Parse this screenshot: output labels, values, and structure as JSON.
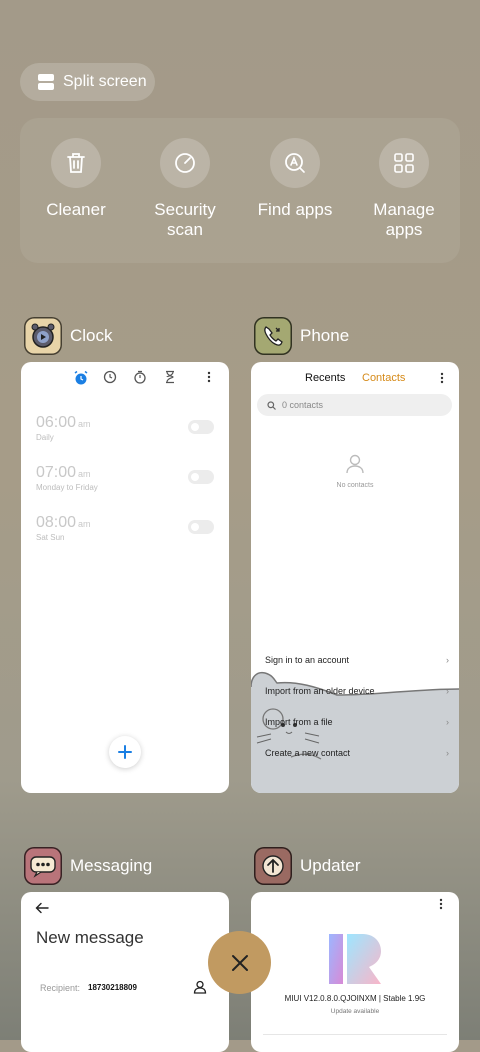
{
  "split_screen": {
    "label": "Split screen",
    "icon": "split-screen-icon"
  },
  "tools": [
    {
      "label": "Cleaner",
      "icon": "trash-icon"
    },
    {
      "label": "Security\nscan",
      "icon": "security-scan-icon"
    },
    {
      "label": "Find apps",
      "icon": "find-apps-icon"
    },
    {
      "label": "Manage\napps",
      "icon": "grid-icon"
    }
  ],
  "apps": {
    "clock": {
      "name": "Clock",
      "alarms": [
        {
          "time": "06:00",
          "ampm": "am",
          "repeat": "Daily"
        },
        {
          "time": "07:00",
          "ampm": "am",
          "repeat": "Monday to Friday"
        },
        {
          "time": "08:00",
          "ampm": "am",
          "repeat": "Sat Sun"
        }
      ]
    },
    "phone": {
      "name": "Phone",
      "tab_recents": "Recents",
      "tab_contacts": "Contacts",
      "search_placeholder": "0 contacts",
      "empty_text": "No contacts",
      "options": [
        "Sign in to an account",
        "Import from an older device",
        "Import from a file",
        "Create a new contact"
      ]
    },
    "messaging": {
      "name": "Messaging",
      "title": "New message",
      "recipient_label": "Recipient:",
      "recipient_value": "18730218809"
    },
    "updater": {
      "name": "Updater",
      "version": "MIUI V12.0.8.0.QJOINXM | Stable 1.9G",
      "status": "Update available"
    }
  },
  "colors": {
    "accent_blue": "#1b7fe3",
    "contacts_orange": "#d68b1a",
    "close_fab": "#c19a61"
  }
}
